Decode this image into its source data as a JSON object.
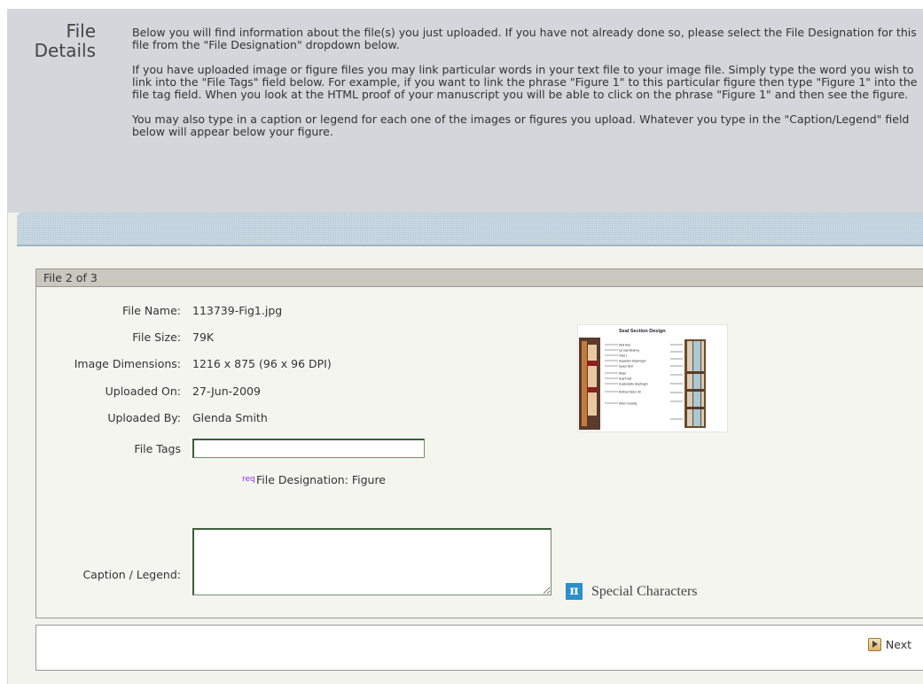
{
  "header": {
    "title_line1": "File",
    "title_line2": "Details",
    "paragraphs": [
      "Below you will find information about the file(s) you just uploaded. If you have not already done so, please select the File Designation for this file from the \"File Designation\" dropdown below.",
      "If you have uploaded image or figure files you may link particular words in your text file to your image file. Simply type the word you wish to link into the \"File Tags\" field below. For example, if you want to link the phrase \"Figure 1\" to this particular figure then type \"Figure 1\" into the file tag field. When you look at the HTML proof of your manuscript you will be able to click on the phrase \"Figure 1\" and then see the figure.",
      "You may also type in a caption or legend for each one of the images or figures you upload. Whatever you type in the \"Caption/Legend\" field below will appear below your figure."
    ]
  },
  "file_box": {
    "header": "File 2 of 3",
    "fields": [
      {
        "label": "File Name:",
        "value": "113739-Fig1.jpg"
      },
      {
        "label": "File Size:",
        "value": "79K"
      },
      {
        "label": "Image Dimensions:",
        "value": "1216 x 875 (96 x 96 DPI)"
      },
      {
        "label": "Uploaded On:",
        "value": "27-Jun-2009"
      },
      {
        "label": "Uploaded By:",
        "value": "Glenda Smith"
      }
    ],
    "file_tags_label": "File Tags",
    "file_tags_value": "",
    "req_label": "req",
    "designation_text": "File Designation: Figure",
    "caption_label": "Caption / Legend:",
    "caption_value": "",
    "special_characters_label": "Special Characters",
    "special_icon_glyph": "π",
    "thumbnail": {
      "title": "Seal Section Design",
      "labels": [
        "Well fluid",
        "Lip seal Bearing",
        "Fluid 1",
        "Separator Diaphragm",
        "Space fluid",
        "Wiper",
        "Seal Fluid",
        "Expandable diaphragm",
        "Refined Motor Oil",
        "Motor housing"
      ]
    }
  },
  "nav": {
    "next_label": "Next"
  },
  "colors": {
    "header_bg": "#d3d6da",
    "panel_bg": "#f3f3ee",
    "blue_bar": "#b7cbd9",
    "file_header_bg": "#c8c8be",
    "pi_icon": "#2b8fcb"
  }
}
